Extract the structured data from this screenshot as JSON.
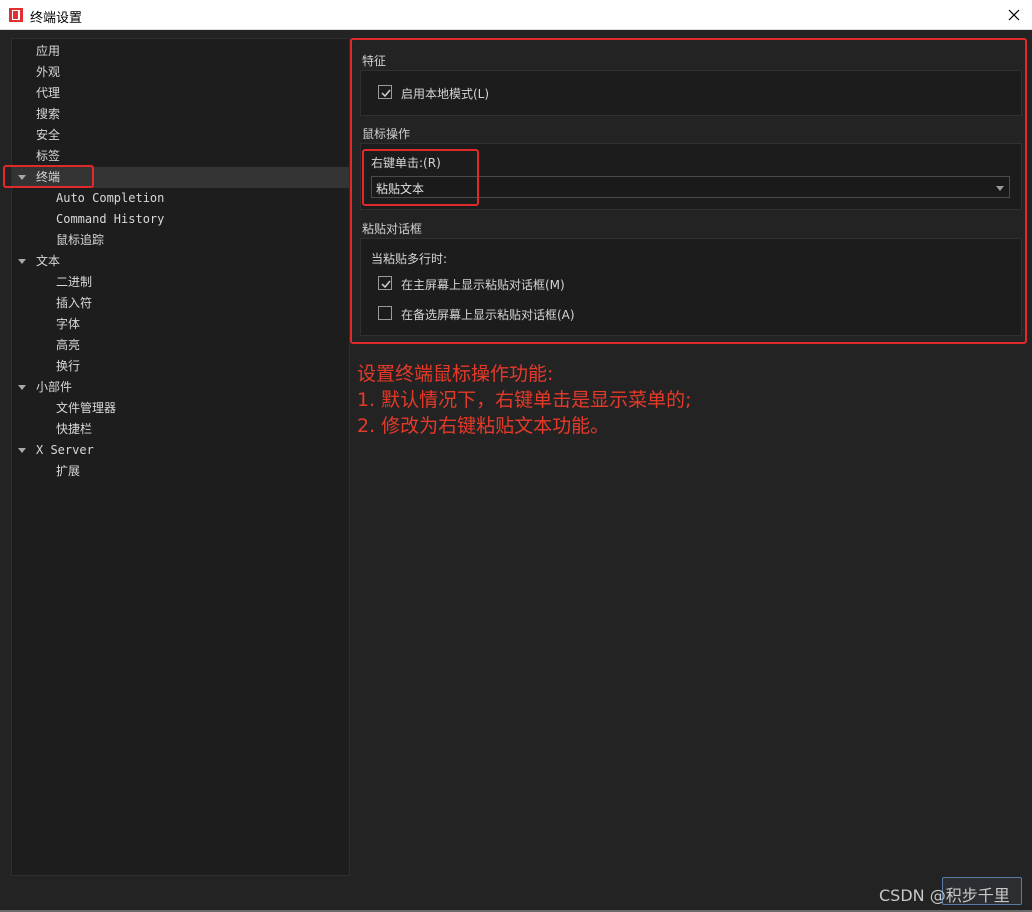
{
  "window": {
    "title": "终端设置",
    "icon": "app-logo-icon",
    "close_icon": "close-icon"
  },
  "tree": {
    "items": [
      {
        "label": "应用"
      },
      {
        "label": "外观"
      },
      {
        "label": "代理"
      },
      {
        "label": "搜索"
      },
      {
        "label": "安全"
      },
      {
        "label": "标签"
      },
      {
        "label": "终端",
        "expanded": true,
        "selected": true
      },
      {
        "label": "Auto Completion"
      },
      {
        "label": "Command History"
      },
      {
        "label": "鼠标追踪"
      },
      {
        "label": "文本",
        "expanded": true
      },
      {
        "label": "二进制"
      },
      {
        "label": "插入符"
      },
      {
        "label": "字体"
      },
      {
        "label": "高亮"
      },
      {
        "label": "换行"
      },
      {
        "label": "小部件",
        "expanded": true
      },
      {
        "label": "文件管理器"
      },
      {
        "label": "快捷栏"
      },
      {
        "label": "X Server",
        "expanded": true
      },
      {
        "label": "扩展"
      }
    ]
  },
  "settings": {
    "feature": {
      "title": "特征",
      "local_mode_label": "启用本地模式(L)",
      "local_mode_checked": true
    },
    "mouse": {
      "title": "鼠标操作",
      "right_click_label": "右键单击:(R)",
      "right_click_value": "粘贴文本"
    },
    "paste_dialog": {
      "title": "粘贴对话框",
      "multiline_label": "当粘贴多行时:",
      "main_screen_label": "在主屏幕上显示粘贴对话框(M)",
      "main_screen_checked": true,
      "alt_screen_label": "在备选屏幕上显示粘贴对话框(A)",
      "alt_screen_checked": false
    }
  },
  "annotation": {
    "line1": "设置终端鼠标操作功能:",
    "line2": "1. 默认情况下，右键单击是显示菜单的;",
    "line3": "2. 修改为右键粘贴文本功能。",
    "color": "#e53a2a"
  },
  "watermark": "CSDN @积步千里",
  "colors": {
    "background": "#232323",
    "panel": "#1d1d1d",
    "highlight_box": "#e02a2a"
  }
}
